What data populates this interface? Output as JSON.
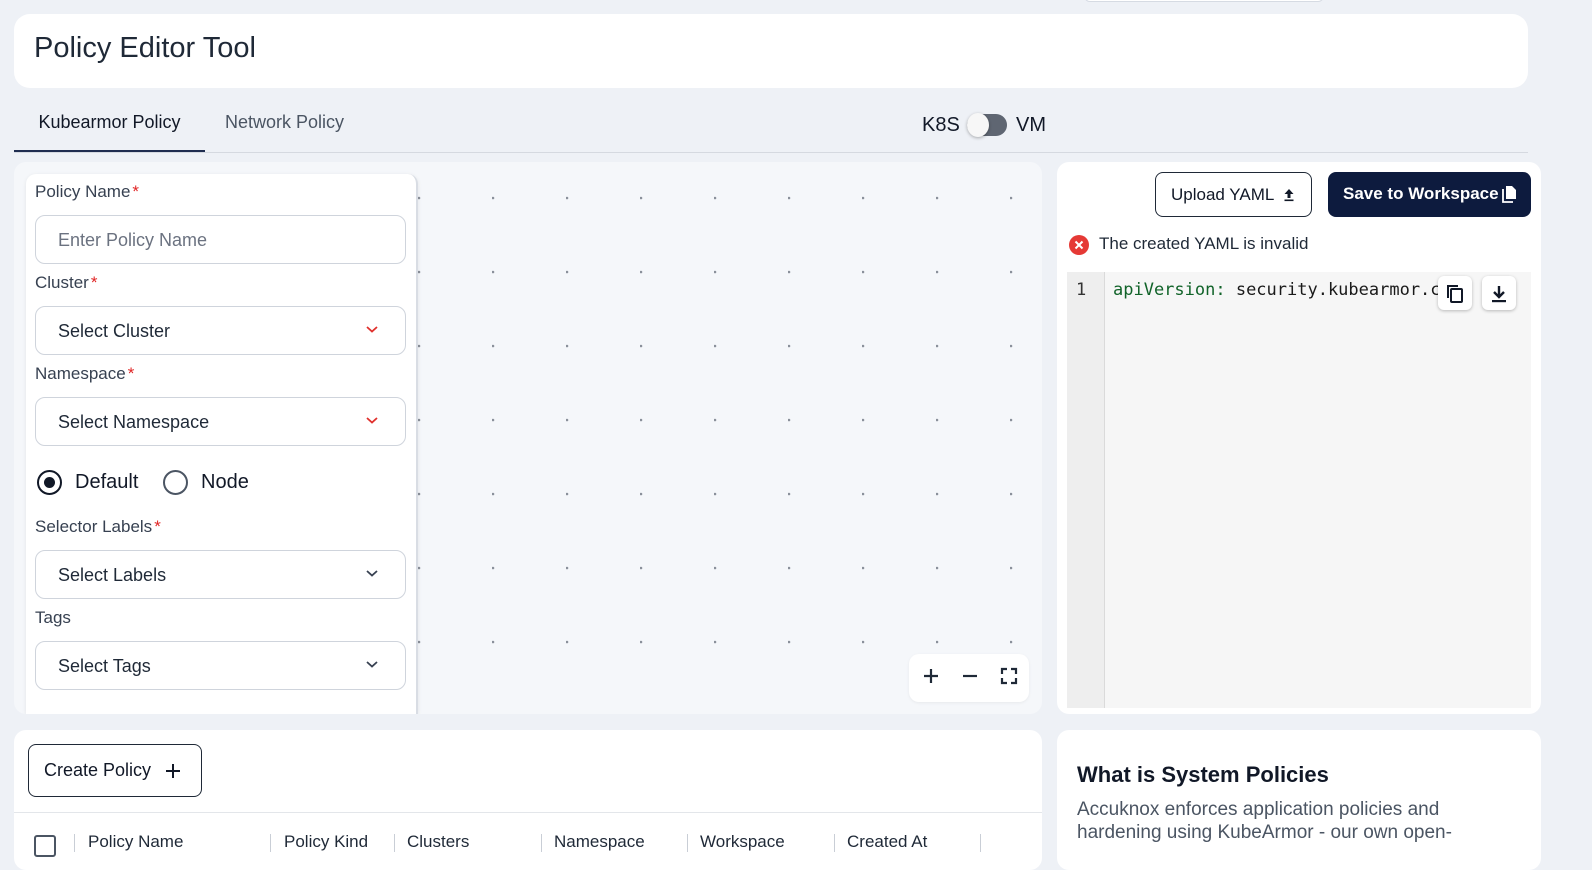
{
  "header": {
    "title": "Policy Editor Tool"
  },
  "tabs": [
    {
      "label": "Kubearmor Policy",
      "active": true
    },
    {
      "label": "Network Policy",
      "active": false
    }
  ],
  "env_toggle": {
    "left_label": "K8S",
    "right_label": "VM",
    "selected": "K8S"
  },
  "form": {
    "policy_name": {
      "label": "Policy Name",
      "required_mark": "*",
      "placeholder": "Enter Policy Name"
    },
    "cluster": {
      "label": "Cluster",
      "required_mark": "*",
      "value": "Select Cluster"
    },
    "namespace": {
      "label": "Namespace",
      "required_mark": "*",
      "value": "Select Namespace"
    },
    "scope_options": [
      {
        "label": "Default",
        "selected": true
      },
      {
        "label": "Node",
        "selected": false
      }
    ],
    "selector_labels": {
      "label": "Selector Labels",
      "required_mark": "*",
      "value": "Select Labels"
    },
    "tags": {
      "label": "Tags",
      "value": "Select Tags"
    }
  },
  "canvas_controls": {
    "zoom_in_icon": "plus-icon",
    "zoom_out_icon": "minus-icon",
    "fit_icon": "fit-view-icon"
  },
  "yaml_panel": {
    "upload_label": "Upload YAML",
    "save_label": "Save to Workspace",
    "error_message": "The created YAML is invalid",
    "lines": [
      {
        "number": "1",
        "key": "apiVersion:",
        "value": " security.kubearmor.com"
      }
    ],
    "copy_icon": "copy-icon",
    "download_icon": "download-icon"
  },
  "policies_table": {
    "create_label": "Create Policy",
    "columns": [
      "Policy Name",
      "Policy Kind",
      "Clusters",
      "Namespace",
      "Workspace",
      "Created At"
    ]
  },
  "info": {
    "title": "What is System Policies",
    "text": "Accuknox enforces application policies and hardening using KubeArmor - our own open-"
  },
  "colors": {
    "primary": "#0d1b3e",
    "error": "#e53935",
    "required": "#e02424",
    "background": "#eef1f6"
  }
}
